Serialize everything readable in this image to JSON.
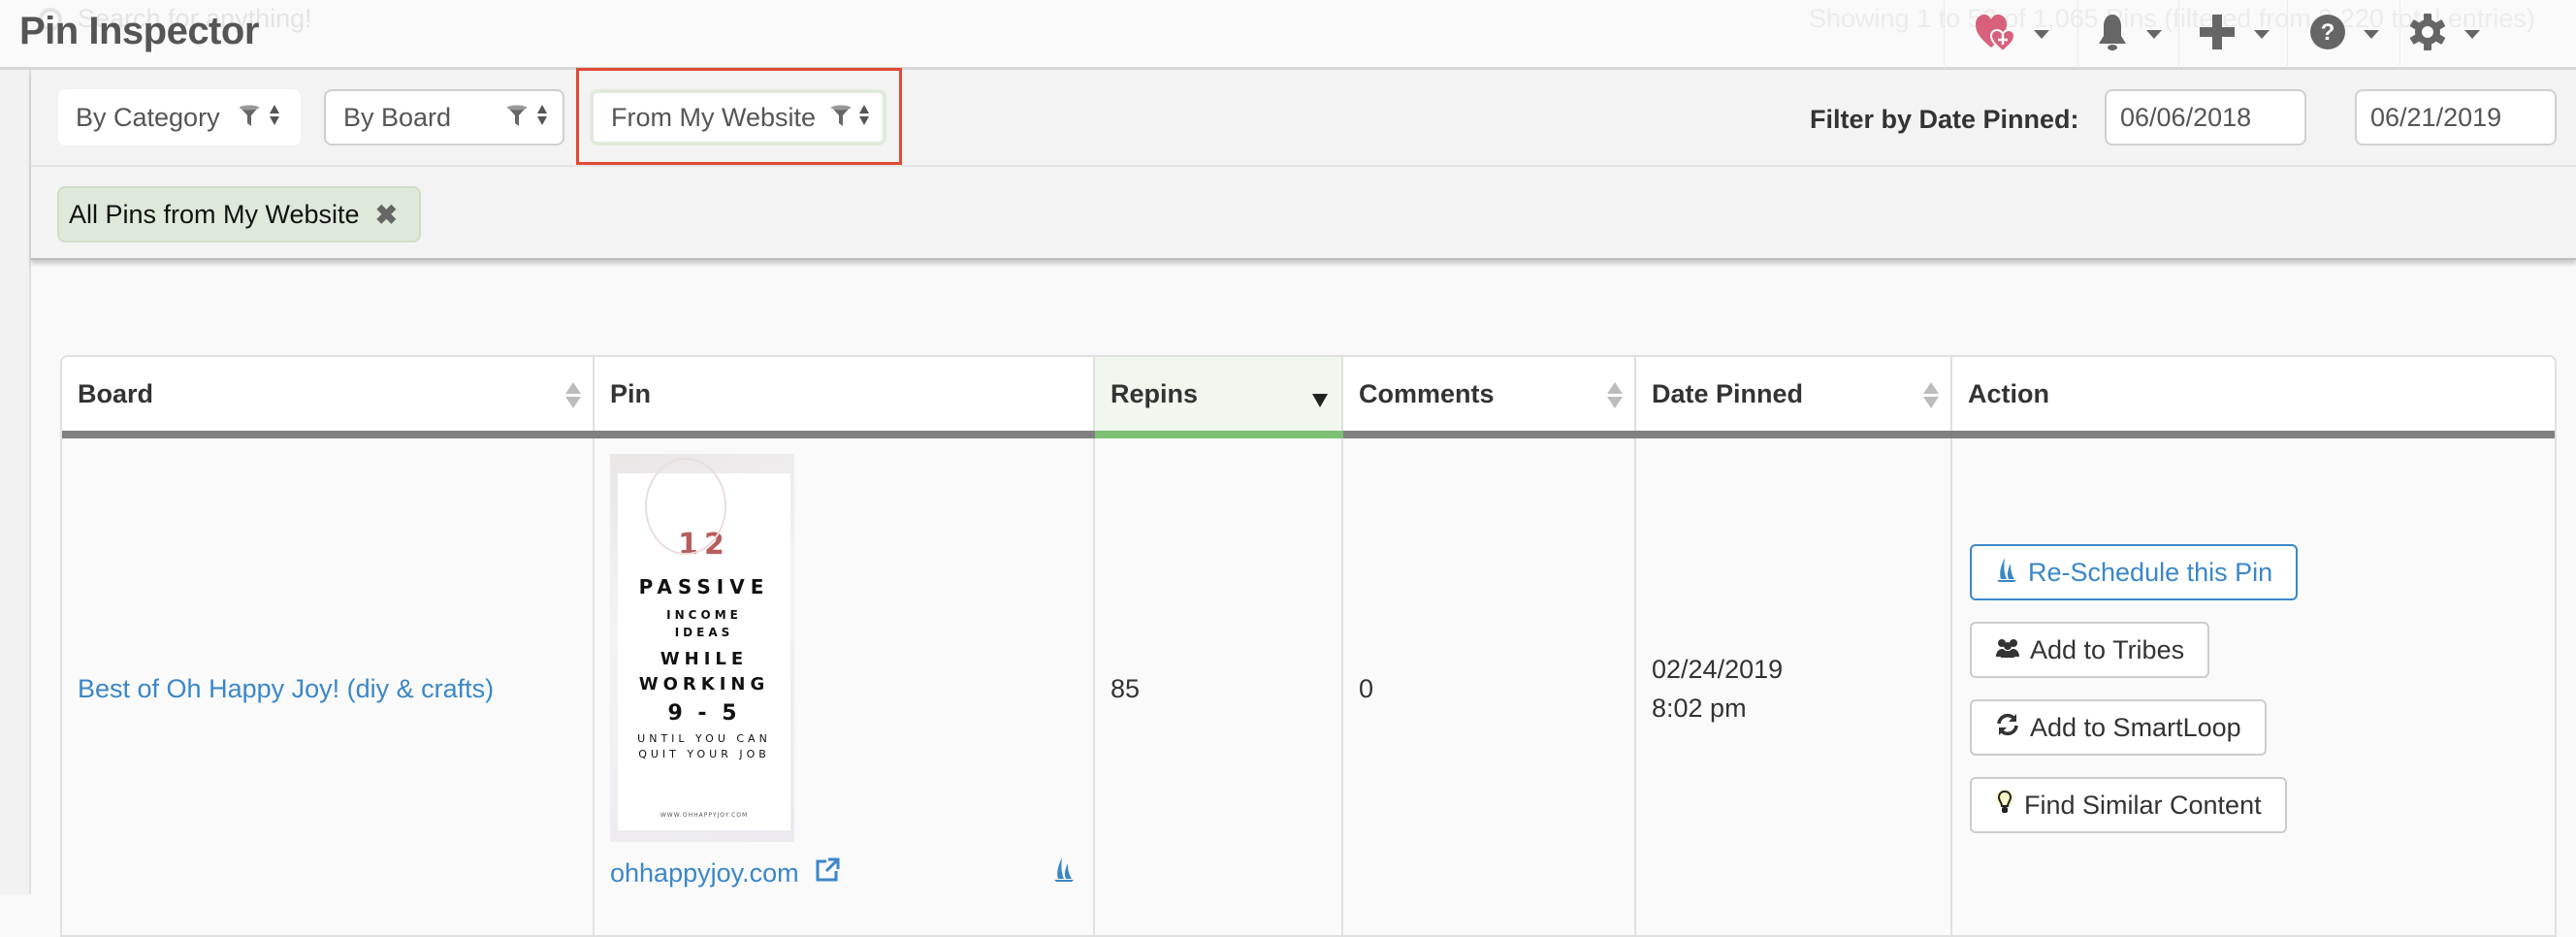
{
  "header": {
    "title": "Pin Inspector",
    "search_placeholder_ghost": "Search for anything!",
    "status_ghost": "Showing 1 to 50 of 1,065 Pins (filtered from 3,220 total entries)",
    "nav_icons": [
      "heart-plus-icon",
      "bell-icon",
      "plus-icon",
      "help-icon",
      "gear-icon"
    ],
    "accent_heart": "#d9607a"
  },
  "filters": {
    "category": "By Category",
    "board": "By Board",
    "source": "From My Website",
    "date_label": "Filter by Date Pinned:",
    "date_from": "06/06/2018",
    "date_separator": "-",
    "date_to": "06/21/2019",
    "active_chip": "All Pins from My Website",
    "chip_remove": "✖"
  },
  "table": {
    "columns": [
      {
        "label": "Board",
        "sort": "none"
      },
      {
        "label": "Pin",
        "sort": "disabled"
      },
      {
        "label": "Repins",
        "sort": "desc"
      },
      {
        "label": "Comments",
        "sort": "none"
      },
      {
        "label": "Date Pinned",
        "sort": "none"
      },
      {
        "label": "Action",
        "sort": "disabled"
      }
    ],
    "rows": [
      {
        "board": "Best of Oh Happy Joy! (diy & crafts)",
        "pin": {
          "image_text": {
            "number": "12",
            "line1": "PASSIVE",
            "line2": "INCOME IDEAS",
            "line3": "WHILE WORKING",
            "line4": "9 - 5",
            "line5": "UNTIL YOU CAN QUIT YOUR JOB",
            "footer": "WWW.OHHAPPYJOY.COM"
          },
          "domain": "ohhappyjoy.com"
        },
        "repins": "85",
        "comments": "0",
        "date": "02/24/2019",
        "time": "8:02 pm",
        "actions": {
          "reschedule": "Re-Schedule this Pin",
          "tribes": "Add to Tribes",
          "smartloop": "Add to SmartLoop",
          "similar": "Find Similar Content"
        }
      }
    ]
  },
  "colors": {
    "link": "#3a87c8",
    "sorted_column": "#7dc174",
    "highlight": "#e04a35",
    "chip_bg": "#dfe9db"
  }
}
